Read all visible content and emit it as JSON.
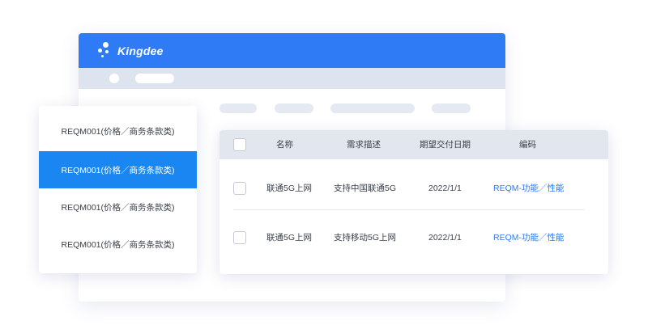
{
  "brand": {
    "name": "Kingdee"
  },
  "sidebar": {
    "items": [
      {
        "label": "REQM001(价格／商务条款类)",
        "active": false
      },
      {
        "label": "REQM001(价格／商务条款类)",
        "active": true
      },
      {
        "label": "REQM001(价格／商务条款类)",
        "active": false
      },
      {
        "label": "REQM001(价格／商务条款类)",
        "active": false
      }
    ]
  },
  "table": {
    "headers": {
      "name": "名称",
      "desc": "需求描述",
      "date": "期望交付日期",
      "code": "编码"
    },
    "rows": [
      {
        "name": "联通5G上网",
        "desc": "支持中国联通5G",
        "date": "2022/1/1",
        "code": "REQM-功能／性能"
      },
      {
        "name": "联通5G上网",
        "desc": "支持移动5G上网",
        "date": "2022/1/1",
        "code": "REQM-功能／性能"
      }
    ]
  },
  "colors": {
    "brand_blue": "#2f7bf5",
    "active_blue": "#1a86f2",
    "link_blue": "#2f7bf5"
  }
}
